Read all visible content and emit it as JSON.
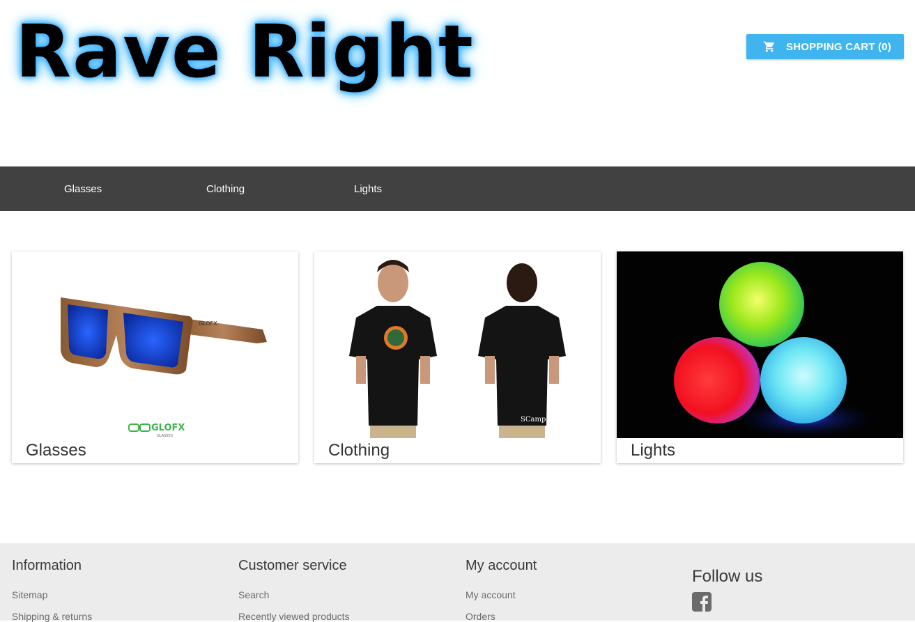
{
  "header": {
    "logo_text": "Rave Right",
    "cart_label": "SHOPPING CART (0)",
    "cart_icon": "shopping-cart-icon"
  },
  "nav": {
    "items": [
      {
        "label": "Glasses"
      },
      {
        "label": "Clothing"
      },
      {
        "label": "Lights"
      }
    ]
  },
  "categories": [
    {
      "label": "Glasses",
      "image": "wooden-sunglasses-blue-lenses",
      "brand": "GLOFX",
      "brand_sub": "GLASSES"
    },
    {
      "label": "Clothing",
      "image": "black-tshirt-front-back",
      "back_print": "SCamp '16"
    },
    {
      "label": "Lights",
      "image": "glowing-juggling-balls"
    }
  ],
  "footer": {
    "columns": [
      {
        "title": "Information",
        "links": [
          "Sitemap",
          "Shipping & returns"
        ]
      },
      {
        "title": "Customer service",
        "links": [
          "Search",
          "Recently viewed products"
        ]
      },
      {
        "title": "My account",
        "links": [
          "My account",
          "Orders"
        ]
      }
    ],
    "follow_title": "Follow us",
    "social_icon": "facebook-icon"
  },
  "colors": {
    "accent": "#3fb4ee",
    "nav_bg": "#414141",
    "footer_bg": "#ececec",
    "logo_glow": "#3fb0ff"
  }
}
